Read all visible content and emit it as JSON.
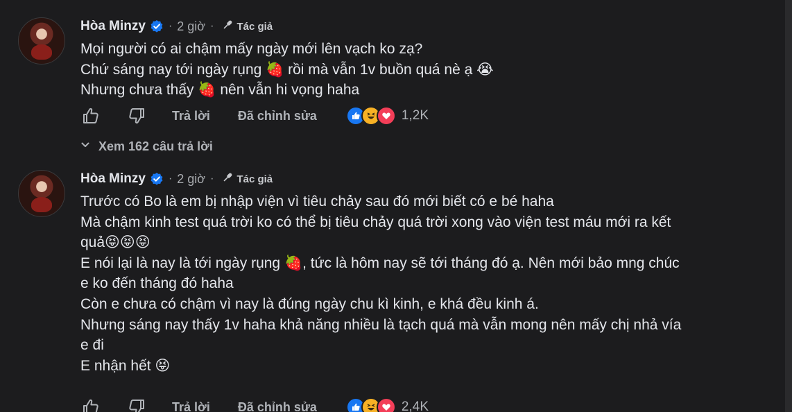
{
  "comments": [
    {
      "author": "Hòa Minzy",
      "time": "2 giờ",
      "badge": "Tác giả",
      "lines": [
        "Mọi người có ai chậm mấy ngày mới lên vạch ko zạ?",
        "Chứ sáng nay tới ngày rụng 🍓 rồi mà vẫn 1v buồn quá nè ạ 😭",
        "Nhưng chưa thấy 🍓 nên vẫn hi vọng haha"
      ],
      "reply_label": "Trả lời",
      "edited_label": "Đã chỉnh sửa",
      "reaction_count": "1,2K"
    },
    {
      "author": "Hòa Minzy",
      "time": "2 giờ",
      "badge": "Tác giả",
      "lines": [
        "Trước có Bo là em bị nhập viện vì tiêu chảy sau đó mới biết có e bé haha",
        "Mà chậm kinh test quá trời ko có thể bị tiêu chảy quá trời xong vào viện test máu mới ra kết",
        "quả😝😝😝",
        "E nói lại là nay là tới ngày rụng 🍓, tức là hôm nay sẽ tới tháng đó ạ. Nên mới bảo mng chúc",
        "e ko đến tháng đó haha",
        "Còn e chưa có chậm vì nay là đúng ngày chu kì kinh, e khá đều kinh á.",
        "Nhưng sáng nay thấy 1v haha khả năng nhiều là tạch quá mà vẫn mong nên mấy chị nhả vía",
        "e đi",
        "E nhận hết 😝"
      ],
      "reply_label": "Trả lời",
      "edited_label": "Đã chỉnh sửa",
      "reaction_count": "2,4K"
    }
  ],
  "view_replies": "Xem 162 câu trả lời",
  "colors": {
    "background": "#1c1c1e",
    "text": "#e4e6eb",
    "muted": "#b0b3b8",
    "verified_blue": "#1877f2",
    "like_blue": "#1877f2",
    "love_red": "#f33e58",
    "haha_yellow": "#f7b125"
  },
  "icons": [
    "verified-badge-icon",
    "microphone-icon",
    "like-icon",
    "dislike-icon",
    "chevron-down-icon",
    "like-reaction-icon",
    "haha-reaction-icon",
    "love-reaction-icon",
    "avatar"
  ]
}
